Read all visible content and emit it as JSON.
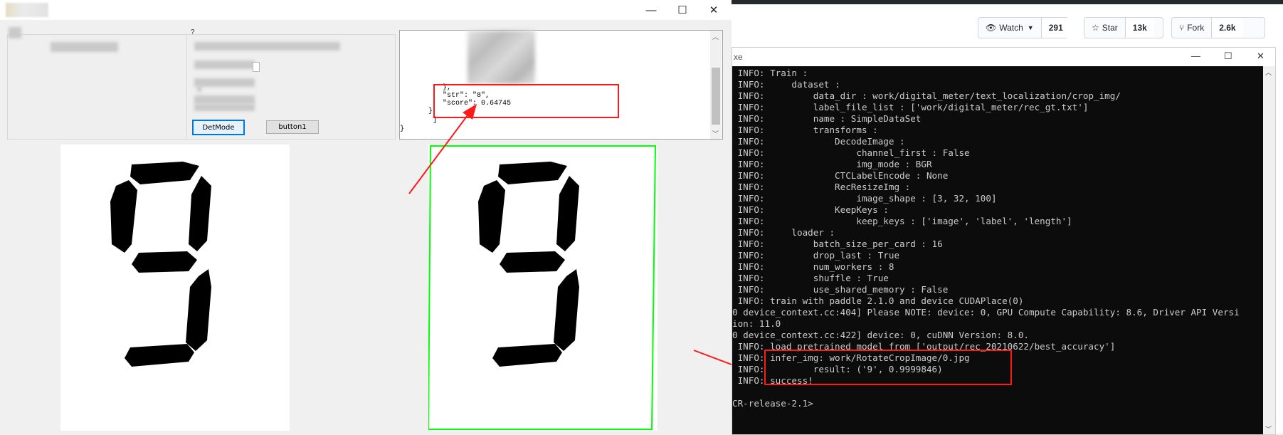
{
  "app_window": {
    "minimize_glyph": "—",
    "maximize_glyph": "☐",
    "close_glyph": "✕",
    "group_label": "?",
    "buttons": {
      "detmode": "DetMode",
      "button1": "button1"
    },
    "textbox_lines": [
      "  },",
      "  \"str\": \"8\",",
      "  \"score\": 0.64745",
      "}",
      "      ]",
      "}"
    ]
  },
  "github": {
    "watch_label": "Watch",
    "watch_count": "291",
    "star_label": "Star",
    "star_count": "13k",
    "fork_label": "Fork",
    "fork_count": "2.6k"
  },
  "console": {
    "title_fragment": "xe",
    "minimize_glyph": "—",
    "maximize_glyph": "☐",
    "close_glyph": "✕",
    "lines": [
      " INFO: Train :",
      " INFO:     dataset :",
      " INFO:         data_dir : work/digital_meter/text_localization/crop_img/",
      " INFO:         label_file_list : ['work/digital_meter/rec_gt.txt']",
      " INFO:         name : SimpleDataSet",
      " INFO:         transforms :",
      " INFO:             DecodeImage :",
      " INFO:                 channel_first : False",
      " INFO:                 img_mode : BGR",
      " INFO:             CTCLabelEncode : None",
      " INFO:             RecResizeImg :",
      " INFO:                 image_shape : [3, 32, 100]",
      " INFO:             KeepKeys :",
      " INFO:                 keep_keys : ['image', 'label', 'length']",
      " INFO:     loader :",
      " INFO:         batch_size_per_card : 16",
      " INFO:         drop_last : True",
      " INFO:         num_workers : 8",
      " INFO:         shuffle : True",
      " INFO:         use_shared_memory : False",
      " INFO: train with paddle 2.1.0 and device CUDAPlace(0)",
      "0 device_context.cc:404] Please NOTE: device: 0, GPU Compute Capability: 8.6, Driver API Versi",
      "ion: 11.0",
      "0 device_context.cc:422] device: 0, cuDNN Version: 8.0.",
      " INFO: load pretrained model from ['output/rec_20210622/best_accuracy']",
      " INFO: infer_img: work/RotateCropImage/0.jpg",
      " INFO:         result: ('9', 0.9999846)",
      " INFO: success!",
      "",
      "CR-release-2.1>"
    ]
  },
  "colors": {
    "annotation_red": "#ff1a1a",
    "detection_box_green": "#00ff00",
    "console_bg": "#0c0c0c",
    "console_text": "#cccccc"
  }
}
